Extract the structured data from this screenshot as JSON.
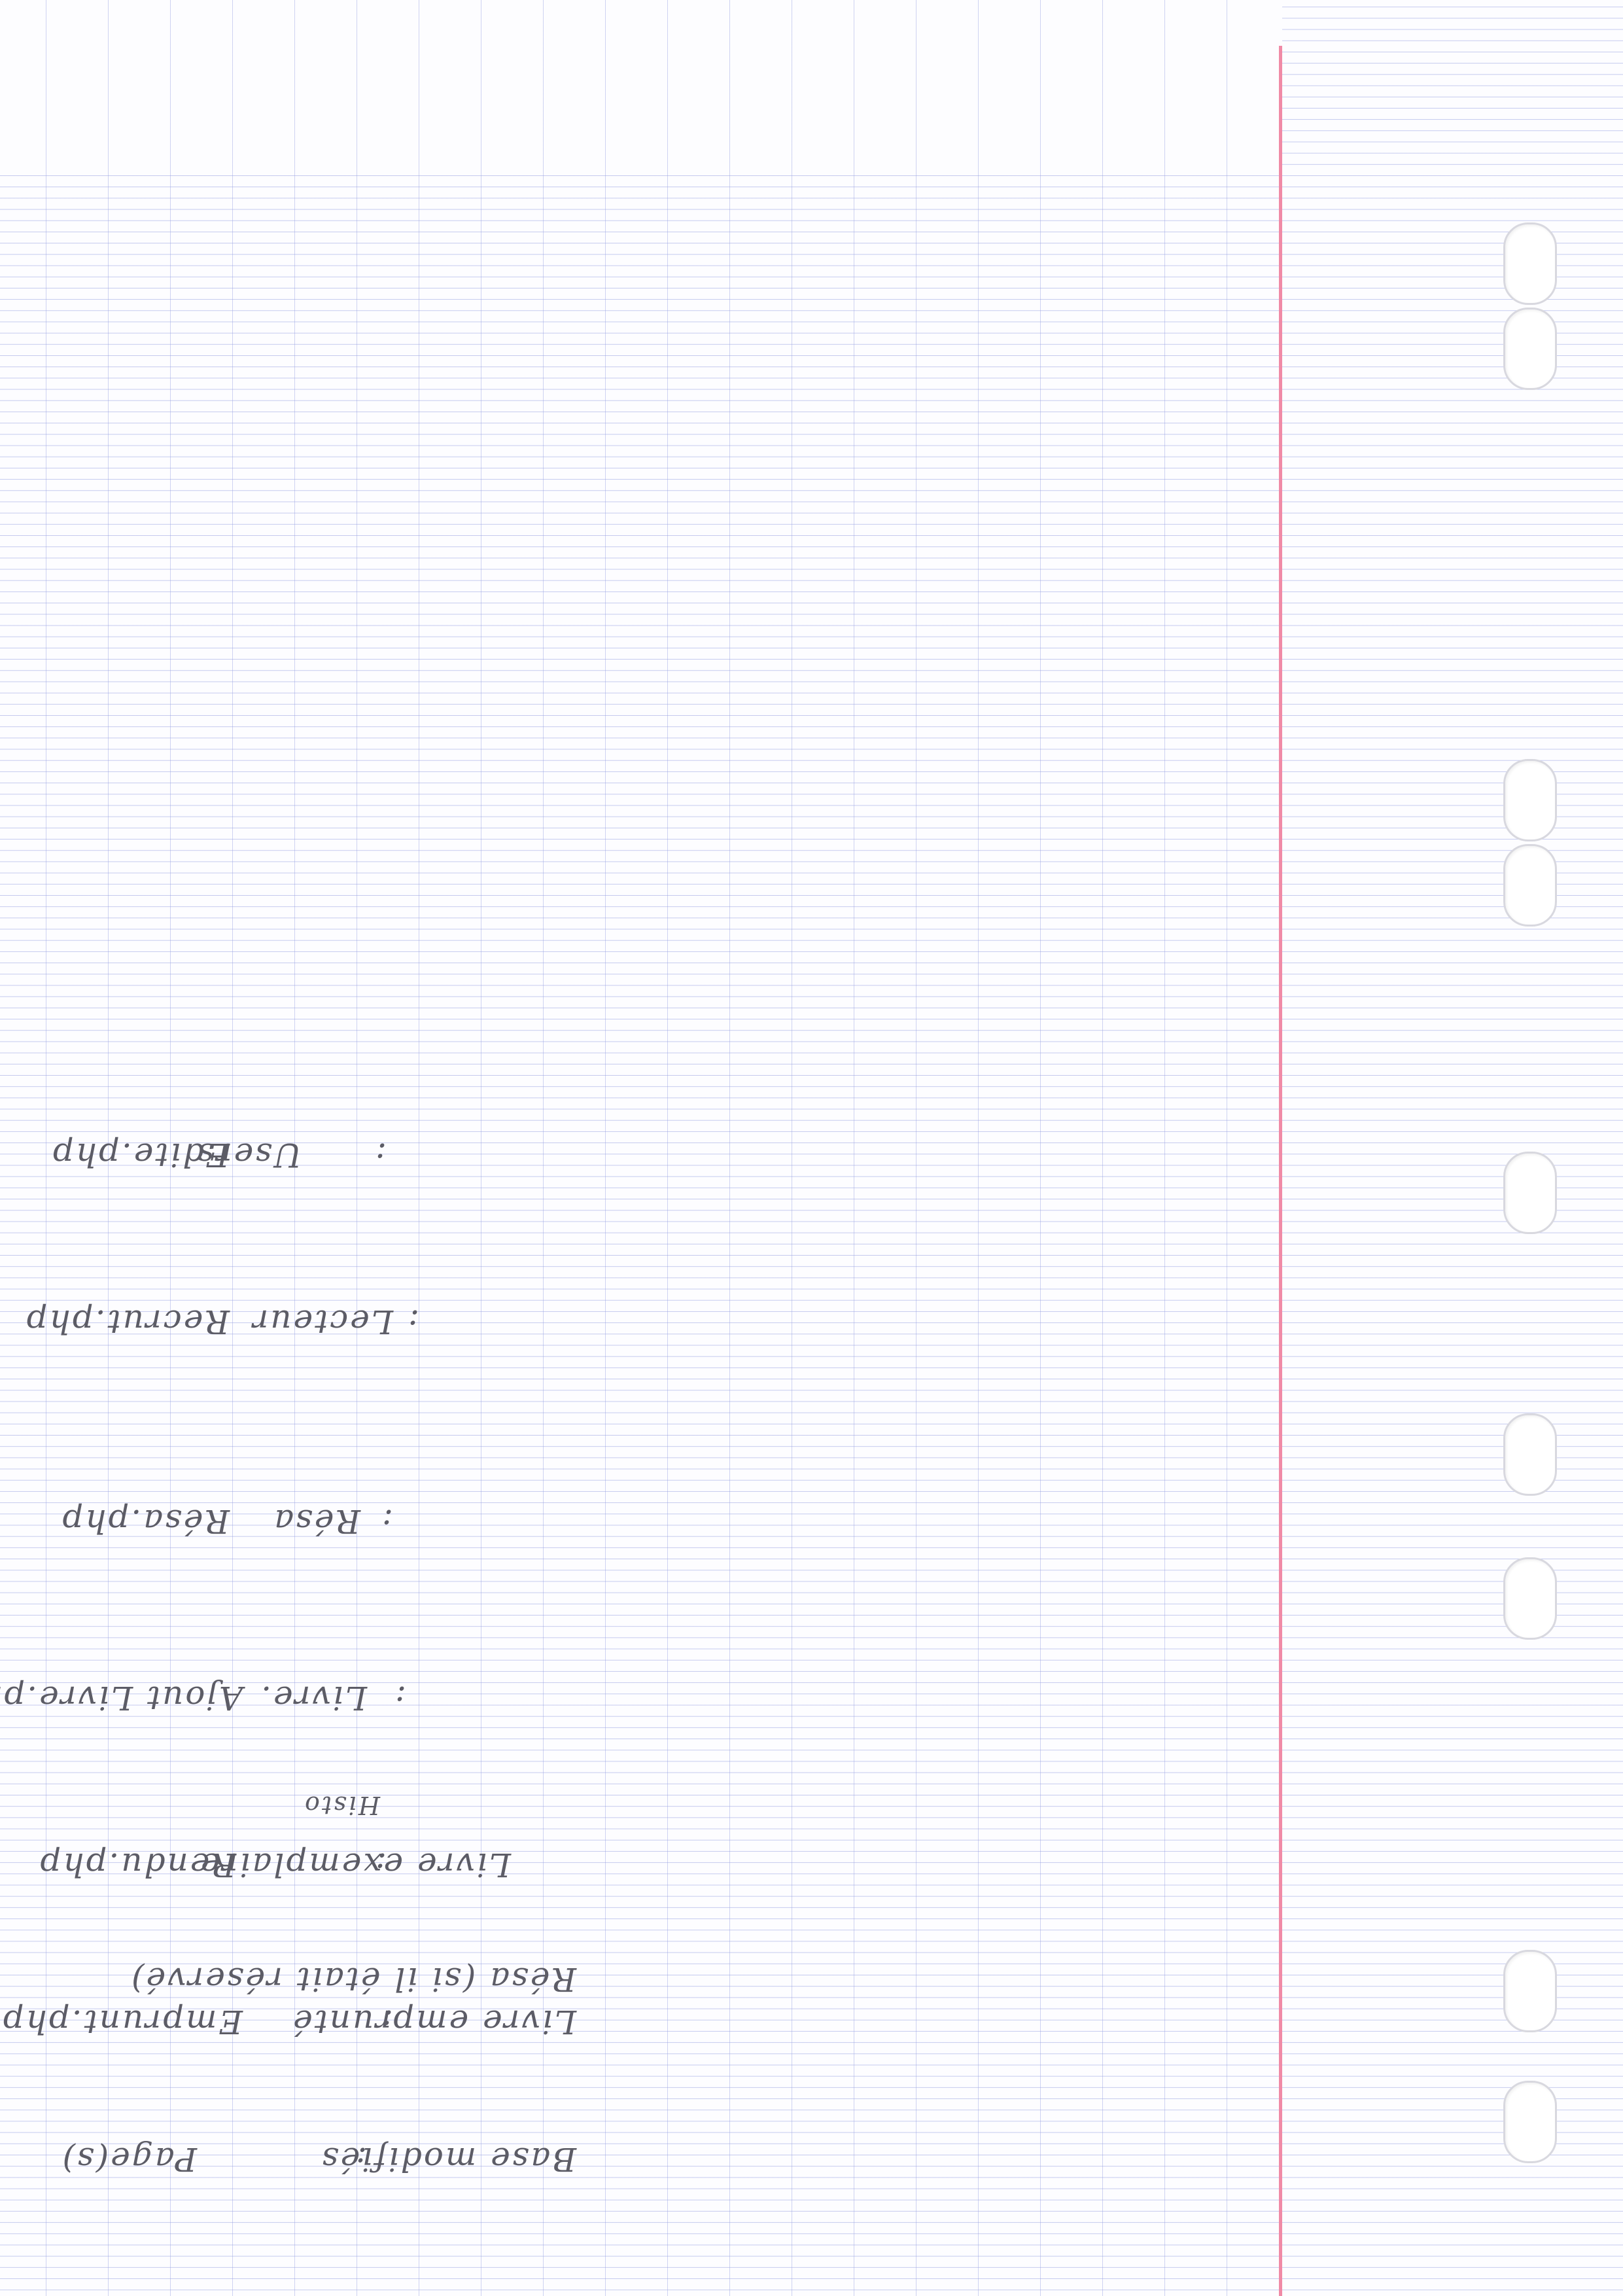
{
  "notes": [
    {
      "id": "pages",
      "label": "Page(s)",
      "sep": ":",
      "value": "Base modifiés"
    },
    {
      "id": "emprunt",
      "label": "Emprunt.php",
      "sep": ":",
      "value": "Livre emprunté",
      "extra": "Résa (si il était réservé)"
    },
    {
      "id": "rendu",
      "label": "Rendu.php",
      "sep": ":",
      "value": "Livre exemplaire",
      "extra": "Histo"
    },
    {
      "id": "ajout-livre",
      "label": "Ajout Livre.php",
      "sep": ":",
      "value": "Livre."
    },
    {
      "id": "resa",
      "label": "Résa.php",
      "sep": ":",
      "value": "Résa"
    },
    {
      "id": "recrut",
      "label": "Recrut.php",
      "sep": ":",
      "value": "Lecteur"
    },
    {
      "id": "edite",
      "label": "Edite.php",
      "sep": ":",
      "value": "Users"
    }
  ]
}
